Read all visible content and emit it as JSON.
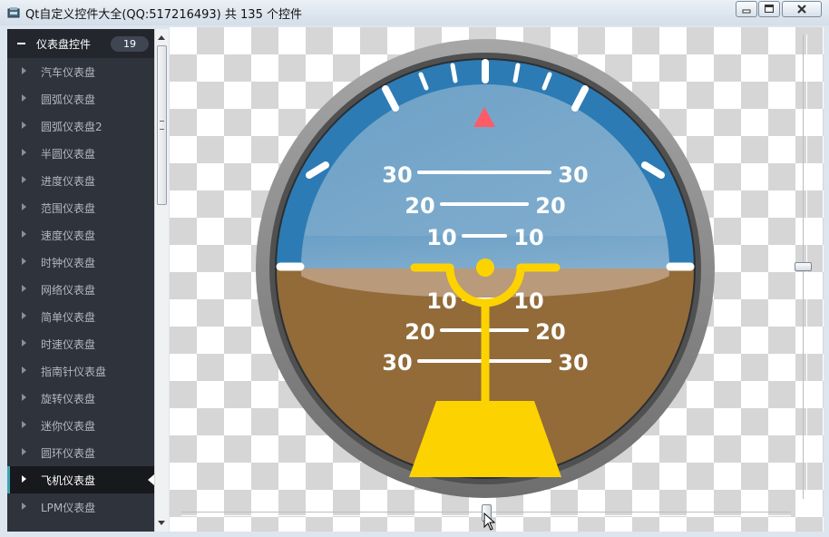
{
  "window": {
    "title": "Qt自定义控件大全(QQ:517216493) 共 135 个控件",
    "controls": [
      "minimize-icon",
      "maximize-icon",
      "close-icon"
    ]
  },
  "sidebar": {
    "group": {
      "title": "仪表盘控件",
      "count": "19",
      "icon": "minus-icon"
    },
    "items": [
      {
        "label": "汽车仪表盘"
      },
      {
        "label": "圆弧仪表盘"
      },
      {
        "label": "圆弧仪表盘2"
      },
      {
        "label": "半圆仪表盘"
      },
      {
        "label": "进度仪表盘"
      },
      {
        "label": "范围仪表盘"
      },
      {
        "label": "速度仪表盘"
      },
      {
        "label": "时钟仪表盘"
      },
      {
        "label": "网络仪表盘"
      },
      {
        "label": "简单仪表盘"
      },
      {
        "label": "时速仪表盘"
      },
      {
        "label": "指南针仪表盘"
      },
      {
        "label": "旋转仪表盘"
      },
      {
        "label": "迷你仪表盘"
      },
      {
        "label": "圆环仪表盘"
      },
      {
        "label": "飞机仪表盘",
        "selected": true
      },
      {
        "label": "LPM仪表盘"
      }
    ]
  },
  "gauge": {
    "type": "attitude-indicator",
    "pitch_labels": {
      "up": [
        "30",
        "20",
        "10"
      ],
      "down": [
        "10",
        "20",
        "30"
      ]
    },
    "colors": {
      "sky": "#7aa8c8",
      "ground": "#926b39",
      "bezel": "#2d7bb4",
      "aircraft": "#fcd300",
      "marker": "#fe5b66",
      "ring": "#9a9a9a"
    }
  },
  "sliders": {
    "vertical": {
      "value_fraction": 0.5
    },
    "horizontal": {
      "value_fraction": 0.5
    }
  }
}
